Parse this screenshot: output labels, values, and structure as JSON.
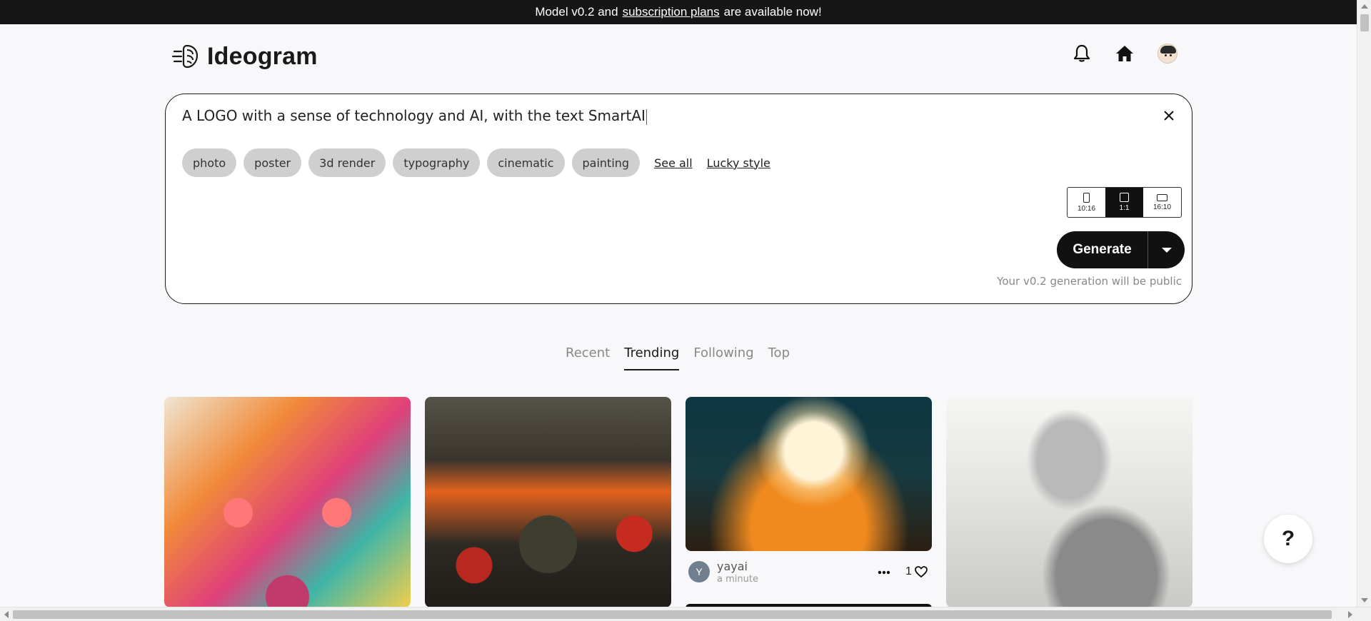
{
  "banner": {
    "prefix": "Model v0.2 and",
    "link": "subscription plans",
    "suffix": "are available now!"
  },
  "header": {
    "logo_text": "Ideogram",
    "icons": [
      "bell-icon",
      "home-icon",
      "avatar"
    ]
  },
  "prompt": {
    "text": "A LOGO with a sense of technology and AI, with the text SmartAI",
    "chips": [
      "photo",
      "poster",
      "3d render",
      "typography",
      "cinematic",
      "painting"
    ],
    "see_all": "See all",
    "lucky_style": "Lucky style",
    "aspect_ratios": [
      {
        "label": "10:16",
        "active": false
      },
      {
        "label": "1:1",
        "active": true
      },
      {
        "label": "16:10",
        "active": false
      }
    ],
    "generate_label": "Generate",
    "public_note": "Your v0.2 generation will be public"
  },
  "tabs": [
    {
      "label": "Recent",
      "active": false
    },
    {
      "label": "Trending",
      "active": true
    },
    {
      "label": "Following",
      "active": false
    },
    {
      "label": "Top",
      "active": false
    }
  ],
  "feed": {
    "cards": [
      {
        "image": "colorful dog portrait"
      },
      {
        "image": "soldiers battlefield"
      },
      {
        "image": "dandelion sunset",
        "user_initial": "Y",
        "user": "yayai",
        "time": "a minute",
        "likes": "1"
      },
      {
        "image": "pencil sketch man with guitar"
      }
    ]
  },
  "help_label": "?",
  "colors": {
    "banner_bg": "#161616",
    "primary": "#111111",
    "chip_bg": "#cfcfcf",
    "page_bg": "#f8f8fa"
  }
}
